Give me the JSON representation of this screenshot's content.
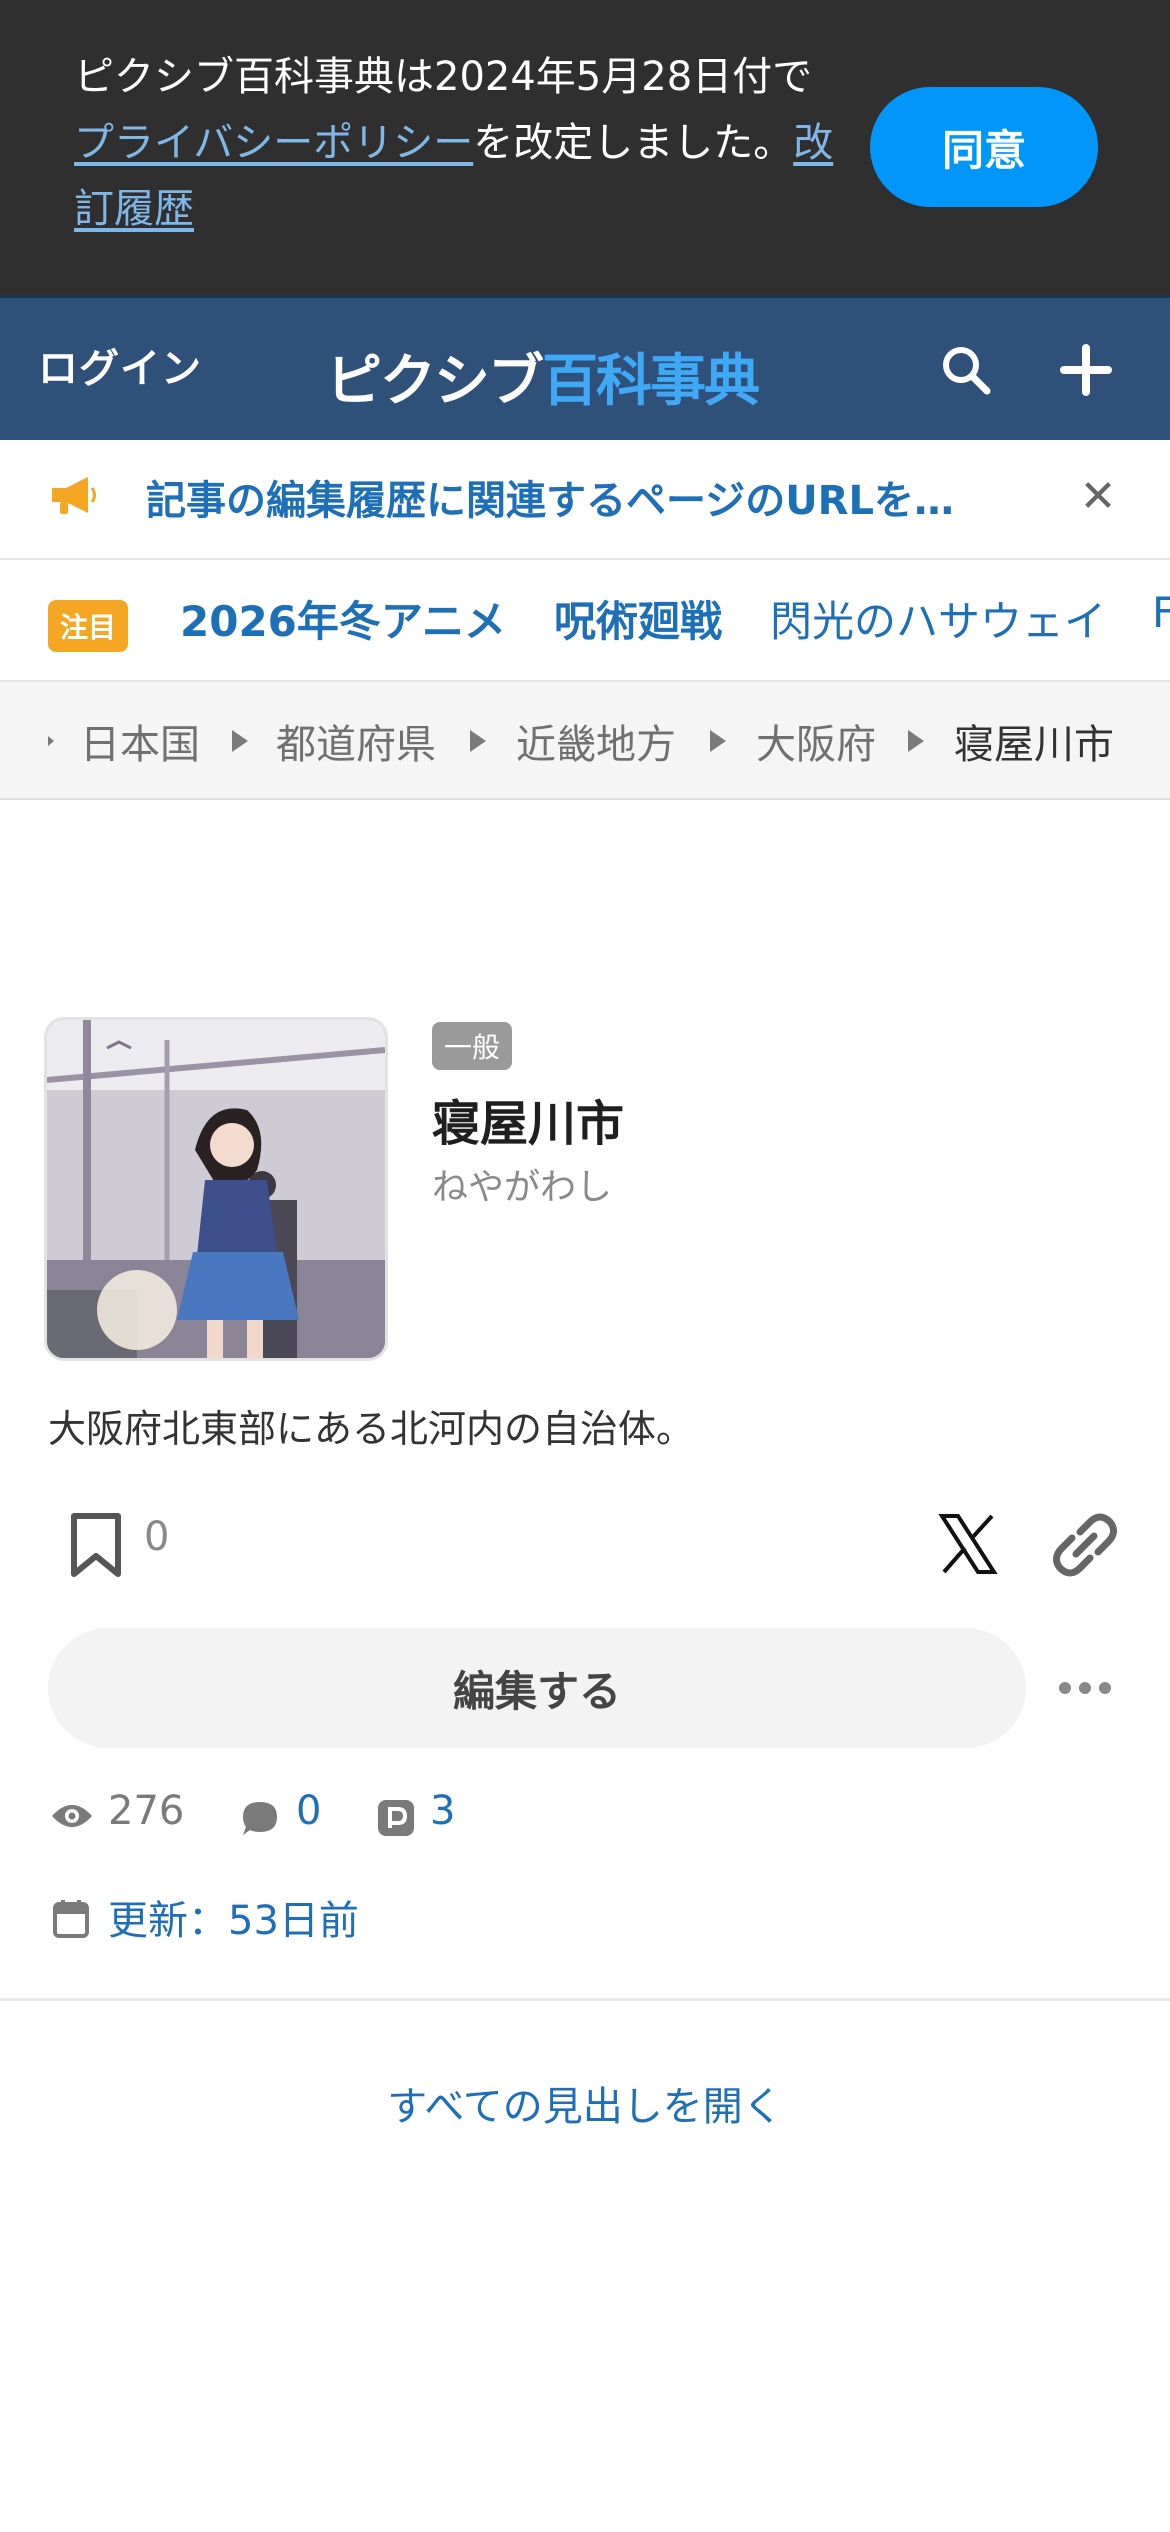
{
  "notice": {
    "text_before": "ピクシブ百科事典は2024年5月28日付で",
    "policy_link": "プライバシーポリシー",
    "text_middle": "を改定しました。",
    "history_link": "改訂履歴",
    "agree_label": "同意"
  },
  "header": {
    "login_label": "ログイン",
    "logo_part1": "ピクシブ",
    "logo_part2": "百科事典",
    "search_icon": "search-icon",
    "add_icon": "plus-icon"
  },
  "announcement": {
    "text": "記事の編集履歴に関連するページのURLを…",
    "icon": "megaphone-icon"
  },
  "trending": {
    "badge": "注目",
    "items": [
      "2026年冬アニメ",
      "呪術廻戦",
      "閃光のハサウェイ",
      "F"
    ]
  },
  "breadcrumb": [
    "日本国",
    "都道府県",
    "近畿地方",
    "大阪府",
    "寝屋川市"
  ],
  "article": {
    "category": "一般",
    "title": "寝屋川市",
    "reading": "ねやがわし",
    "summary": "大阪府北東部にある北河内の自治体。",
    "bookmark_count": "0",
    "edit_label": "編集する",
    "views": "276",
    "comments": "0",
    "pixiv_works": "3",
    "updated": "更新：53日前"
  },
  "open_all_label": "すべての見出しを開く",
  "colors": {
    "notice_bg": "#2f2f2f",
    "header_bg": "#2e5079",
    "agree_btn": "#0096fa",
    "link_blue": "#1d6fb8",
    "badge_orange": "#f5a623"
  }
}
